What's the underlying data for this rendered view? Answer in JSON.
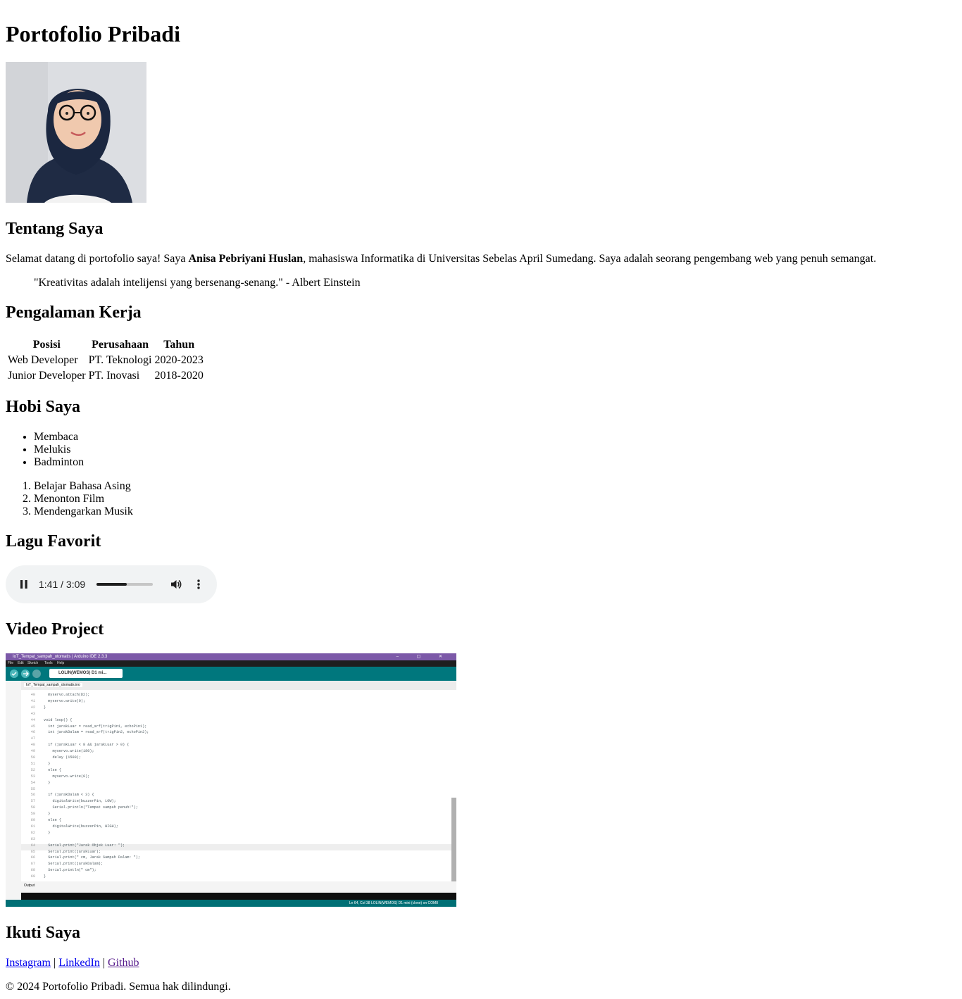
{
  "page": {
    "title": "Portofolio Pribadi"
  },
  "about": {
    "heading": "Tentang Saya",
    "intro_prefix": "Selamat datang di portofolio saya! Saya ",
    "name": "Anisa Pebriyani Huslan",
    "intro_suffix": ", mahasiswa Informatika di Universitas Sebelas April Sumedang. Saya adalah seorang pengembang web yang penuh semangat.",
    "quote": "\"Kreativitas adalah intelijensi yang bersenang-senang.\" - Albert Einstein"
  },
  "experience": {
    "heading": "Pengalaman Kerja",
    "columns": [
      "Posisi",
      "Perusahaan",
      "Tahun"
    ],
    "rows": [
      [
        "Web Developer",
        "PT. Teknologi",
        "2020-2023"
      ],
      [
        "Junior Developer",
        "PT. Inovasi",
        "2018-2020"
      ]
    ]
  },
  "hobbies": {
    "heading": "Hobi Saya",
    "unordered": [
      "Membaca",
      "Melukis",
      "Badminton"
    ],
    "ordered": [
      "Belajar Bahasa Asing",
      "Menonton Film",
      "Mendengarkan Musik"
    ]
  },
  "music": {
    "heading": "Lagu Favorit",
    "player": {
      "state": "playing",
      "time": "1:41 / 3:09",
      "progress": 0.534,
      "volume_icon": "volume-icon",
      "pause_icon": "pause-icon",
      "menu_icon": "more-vert-icon"
    }
  },
  "video": {
    "heading": "Video Project",
    "window_title": "IoT_Tempat_sampah_otomatis | Arduino IDE 2.3.3",
    "menu": [
      "File",
      "Edit",
      "Sketch",
      "Tools",
      "Help"
    ],
    "board": "LOLIN(WEMOS) D1 mi...",
    "tab": "IoT_Tempat_sampah_otomatis.ino",
    "output_label": "Output",
    "status": "Ln 64, Col 38    LOLIN(WEMOS) D1 mini (clone) on COM8",
    "line_numbers": [
      "40",
      "41",
      "42",
      "43",
      "44",
      "45",
      "46",
      "47",
      "48",
      "49",
      "50",
      "51",
      "52",
      "53",
      "54",
      "55",
      "56",
      "57",
      "58",
      "59",
      "60",
      "61",
      "62",
      "63",
      "64",
      "65",
      "66",
      "67",
      "68",
      "69"
    ],
    "code_lines": [
      "  myservo.attach(D2);",
      "  myservo.write(0);",
      "}",
      "",
      "void loop() {",
      "  int jarakLuar = read_srf(trigPin1, echoPin1);",
      "  int jarakDalam = read_srf(trigPin2, echoPin2);",
      "",
      "  if (jarakLuar < 8 && jarakLuar > 0) {",
      "    myservo.write(180);",
      "    delay (1500);",
      "  }",
      "  else {",
      "    myservo.write(0);",
      "  }",
      "",
      "  if (jarakDalam < 3) {",
      "    digitalWrite(buzzerPin, LOW);",
      "    Serial.println(\"Tempat sampah penuh!\");",
      "  }",
      "  else {",
      "    digitalWrite(buzzerPin, HIGH);",
      "  }",
      "",
      "  Serial.print(\"Jarak Objek Luar: \");",
      "  Serial.print(jarakLuar);",
      "  Serial.print(\" cm, Jarak Sampah Dalam: \");",
      "  Serial.print(jarakDalam);",
      "  Serial.println(\" cm\");",
      "}"
    ],
    "colors": {
      "title_bar": "#7c59a8",
      "toolbar": "#00777d",
      "status_bar": "#006f75"
    }
  },
  "social": {
    "heading": "Ikuti Saya",
    "links": [
      "Instagram",
      "LinkedIn",
      "Github"
    ],
    "separator": " | "
  },
  "footer": {
    "text": "© 2024 Portofolio Pribadi. Semua hak dilindungi."
  }
}
